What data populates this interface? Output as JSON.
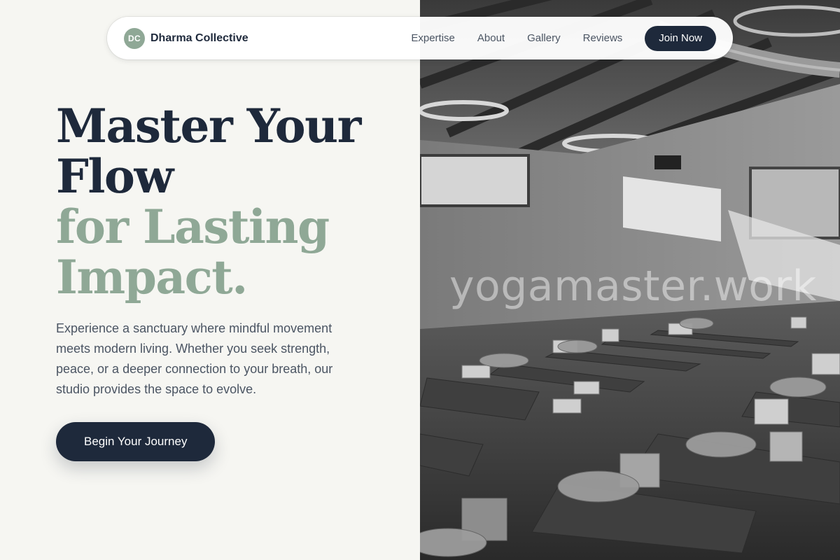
{
  "header": {
    "logo_initials": "DC",
    "brand_name": "Dharma Collective",
    "nav": [
      {
        "label": "Expertise"
      },
      {
        "label": "About"
      },
      {
        "label": "Gallery"
      },
      {
        "label": "Reviews"
      }
    ],
    "cta_label": "Join Now"
  },
  "hero": {
    "title_line1": "Master Your",
    "title_line2": "Flow",
    "title_line3": "for Lasting",
    "title_line4": "Impact.",
    "description": "Experience a sanctuary where mindful movement meets modern living. Whether you seek strength, peace, or a deeper connection to your breath, our studio provides the space to evolve.",
    "cta_label": "Begin Your Journey"
  },
  "image": {
    "description_icon": "yoga-studio-photo",
    "watermark": "yogamaster.work"
  },
  "colors": {
    "navy": "#1e293b",
    "sage": "#8fa896",
    "background": "#f6f6f2",
    "text_muted": "#4b5563"
  }
}
